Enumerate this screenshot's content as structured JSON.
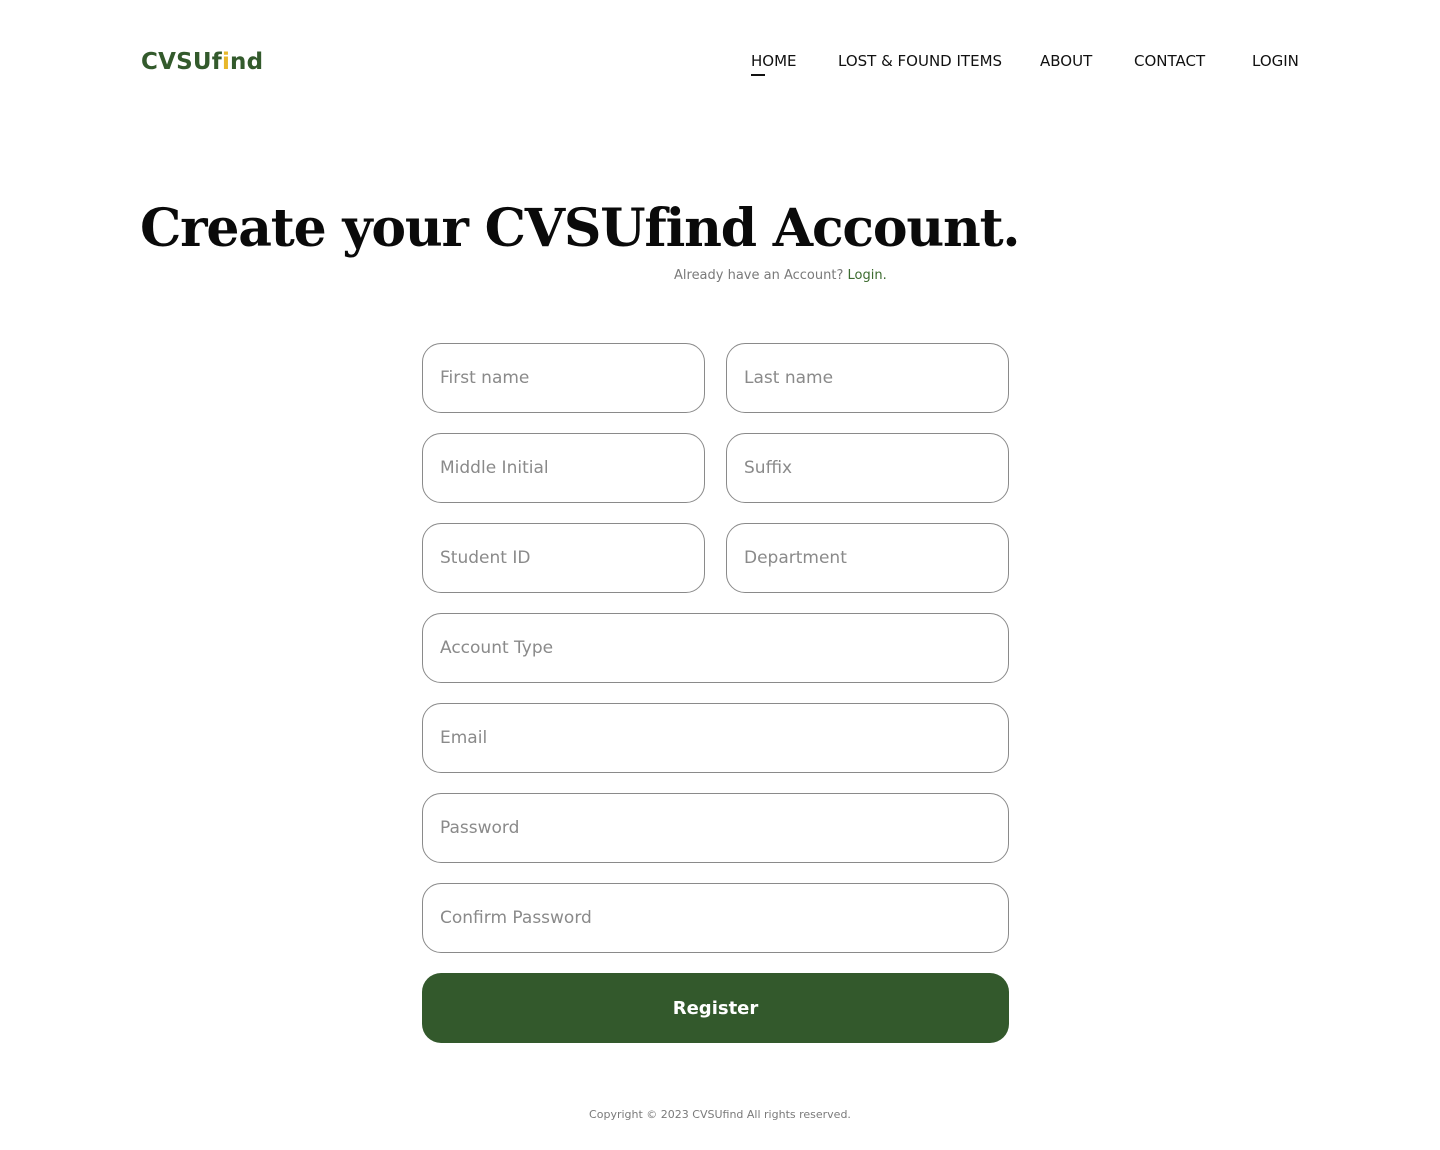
{
  "header": {
    "logo_main": "CVSU",
    "logo_f": "f",
    "logo_i": "i",
    "logo_nd": "nd",
    "nav": [
      {
        "label": "HOME"
      },
      {
        "label": "LOST & FOUND ITEMS"
      },
      {
        "label": "ABOUT"
      },
      {
        "label": "CONTACT"
      },
      {
        "label": "LOGIN"
      }
    ]
  },
  "main": {
    "title": "Create your CVSUfind Account.",
    "login_prompt": "Already have an Account?",
    "login_link": "Login."
  },
  "form": {
    "first_name": {
      "placeholder": "First name",
      "value": ""
    },
    "last_name": {
      "placeholder": "Last name",
      "value": ""
    },
    "middle_initial": {
      "placeholder": "Middle Initial",
      "value": ""
    },
    "suffix": {
      "placeholder": "Suffix",
      "value": ""
    },
    "student_id": {
      "placeholder": "Student ID",
      "value": ""
    },
    "department": {
      "placeholder": "Department",
      "value": ""
    },
    "account_type": {
      "placeholder": "Account Type",
      "value": ""
    },
    "email": {
      "placeholder": "Email",
      "value": ""
    },
    "password": {
      "placeholder": "Password",
      "value": ""
    },
    "confirm_password": {
      "placeholder": "Confirm Password",
      "value": ""
    },
    "register_label": "Register"
  },
  "footer": {
    "copyright": "Copyright © 2023 CVSUfind All rights reserved."
  },
  "colors": {
    "brand_green": "#335a2c",
    "brand_yellow": "#e8b72a",
    "button_green": "#33592c"
  }
}
